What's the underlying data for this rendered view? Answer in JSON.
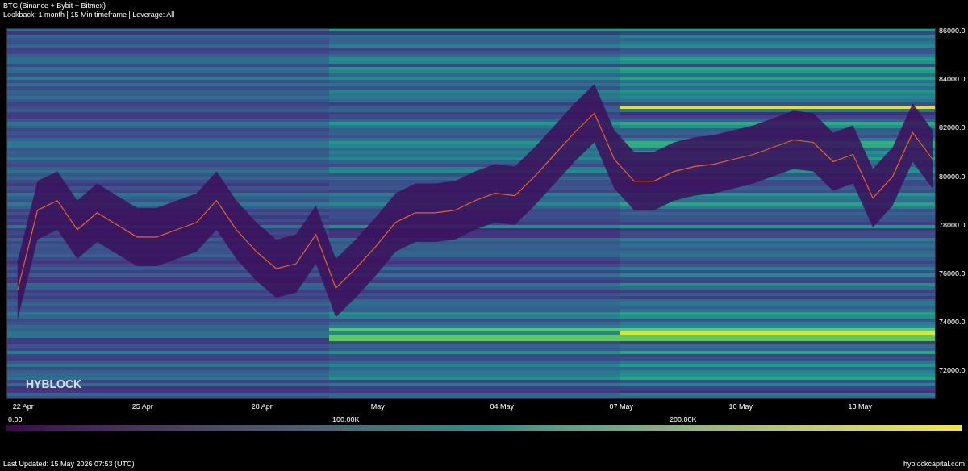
{
  "header": {
    "title": "BTC (Binance + Bybit + Bitmex)",
    "subtitle": "Lookback: 1 month | 15 Min timeframe | Leverage: All"
  },
  "chart": {
    "logo": "HYBLOCK",
    "chart_data": {
      "type": "line",
      "ylim": [
        70817,
        86100
      ],
      "categories": [
        "22 Apr",
        null,
        null,
        null,
        null,
        null,
        "25 Apr",
        null,
        null,
        null,
        null,
        null,
        "28 Apr",
        null,
        null,
        null,
        null,
        null,
        "May",
        null,
        null,
        null,
        null,
        null,
        "04 May",
        null,
        null,
        null,
        null,
        null,
        "07 May",
        null,
        null,
        null,
        null,
        null,
        "10 May",
        null,
        null,
        null,
        null,
        null,
        "13 May",
        null,
        null,
        null,
        null
      ],
      "series": [
        {
          "color": "#e8642a",
          "values": [
            75300,
            78600,
            79000,
            77800,
            78500,
            78000,
            77500,
            77500,
            77800,
            78100,
            79000,
            77800,
            76900,
            76200,
            76400,
            77600,
            75400,
            76200,
            77100,
            78100,
            78500,
            78500,
            78600,
            79000,
            79300,
            79200,
            80000,
            80900,
            81800,
            82600,
            80700,
            79800,
            79800,
            80200,
            80400,
            80500,
            80700,
            80900,
            81200,
            81500,
            81400,
            80600,
            80900,
            79100,
            80000,
            81800,
            80700
          ]
        }
      ],
      "yticks": [
        {
          "value": 86000,
          "label": "86000.0"
        },
        {
          "value": 84000,
          "label": "84000.0"
        },
        {
          "value": 82000,
          "label": "82000.0"
        },
        {
          "value": 80000,
          "label": "80000.0"
        },
        {
          "value": 78000,
          "label": "78000.0"
        },
        {
          "value": 76000,
          "label": "76000.0"
        },
        {
          "value": 74000,
          "label": "74000.0"
        },
        {
          "value": 72000,
          "label": "72000.0"
        }
      ]
    }
  },
  "colorbar": {
    "labels": [
      "0.00",
      "100.00K",
      "200.00K"
    ]
  },
  "footer": {
    "updated": "Last Updated: 15 May 2026 07:53 (UTC)",
    "site": "hyblockcapital.com"
  }
}
